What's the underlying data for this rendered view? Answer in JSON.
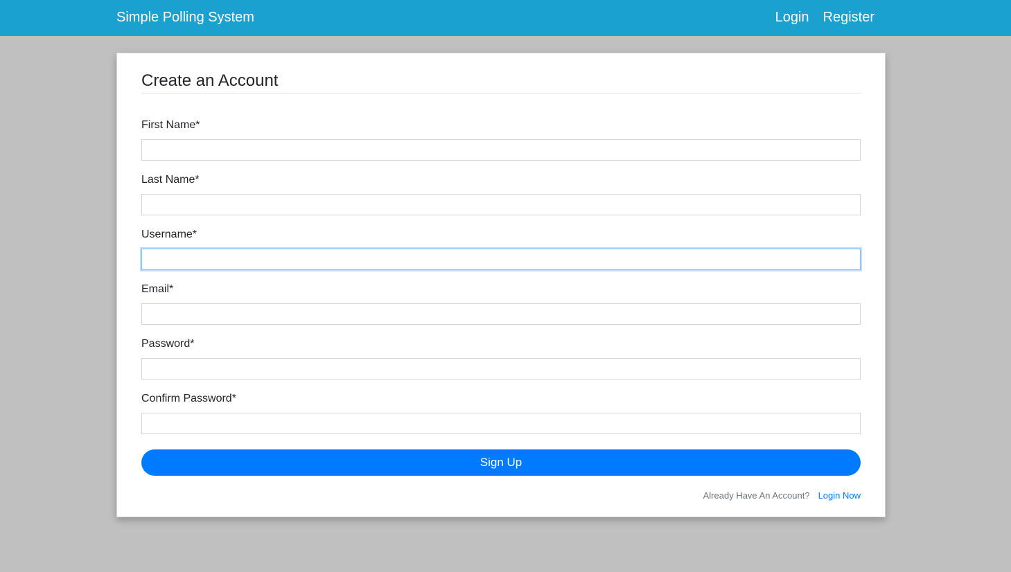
{
  "navbar": {
    "brand": "Simple Polling System",
    "links": [
      "Login",
      "Register"
    ],
    "background": "#1ba1cf"
  },
  "form": {
    "title": "Create an Account",
    "fields": [
      {
        "label": "First Name*",
        "value": ""
      },
      {
        "label": "Last Name*",
        "value": ""
      },
      {
        "label": "Username*",
        "value": ""
      },
      {
        "label": "Email*",
        "value": ""
      },
      {
        "label": "Password*",
        "value": ""
      },
      {
        "label": "Confirm Password*",
        "value": ""
      }
    ],
    "submit_label": "Sign Up",
    "submit_color": "#007bff",
    "footer_text": "Already Have An Account?",
    "footer_link": "Login Now"
  }
}
